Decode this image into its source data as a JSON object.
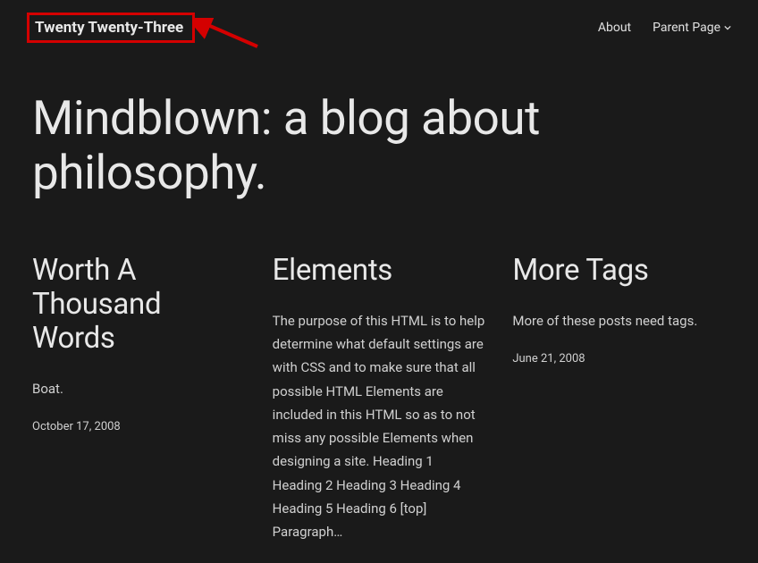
{
  "header": {
    "site_title": "Twenty Twenty-Three",
    "nav": {
      "about": "About",
      "parent_page": "Parent Page"
    }
  },
  "main": {
    "title": "Mindblown: a blog about philosophy."
  },
  "posts": [
    {
      "title": "Worth A Thousand Words",
      "excerpt": "Boat.",
      "date": "October 17, 2008"
    },
    {
      "title": "Elements",
      "excerpt": "The purpose of this HTML is to help determine what default settings are with CSS and to make sure that all possible HTML Elements are included in this HTML so as to not miss any possible Elements when designing a site. Heading 1 Heading 2 Heading 3 Heading 4 Heading 5 Heading 6 [top] Paragraph…",
      "date": ""
    },
    {
      "title": "More Tags",
      "excerpt": "More of these posts need tags.",
      "date": "June 21, 2008"
    }
  ]
}
